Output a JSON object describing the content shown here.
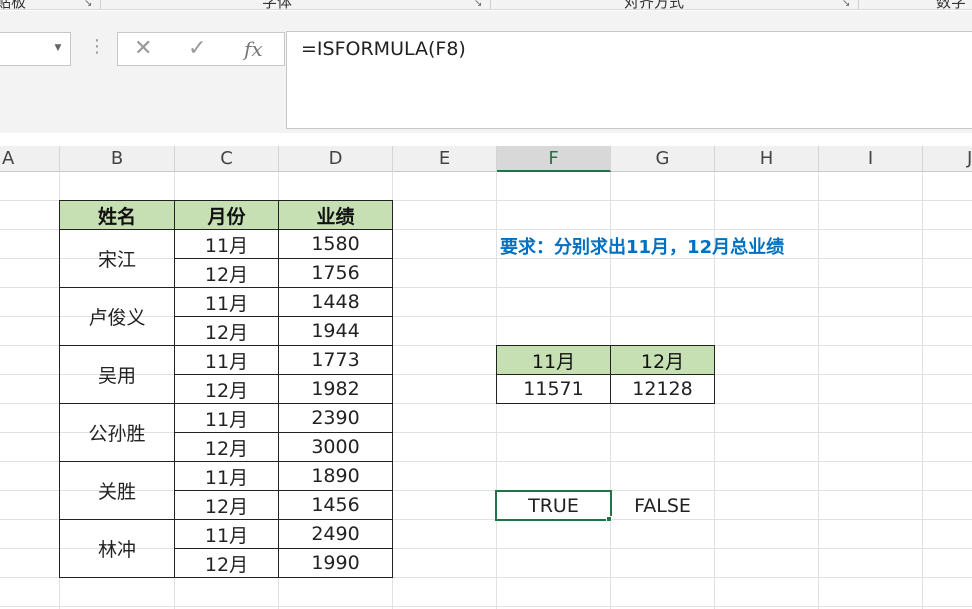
{
  "ribbon": {
    "groups": [
      {
        "label": "贴板"
      },
      {
        "label": "字体"
      },
      {
        "label": "对齐方式"
      },
      {
        "label": "数字"
      }
    ],
    "launcher_icon": "dialog-launcher-icon"
  },
  "formula_bar": {
    "name_box": "",
    "cancel_icon": "✕",
    "enter_icon": "✓",
    "fx_label": "fx",
    "formula": "=ISFORMULA(F8)"
  },
  "columns": [
    {
      "label": "A",
      "selected": false
    },
    {
      "label": "B",
      "selected": false
    },
    {
      "label": "C",
      "selected": false
    },
    {
      "label": "D",
      "selected": false
    },
    {
      "label": "E",
      "selected": false
    },
    {
      "label": "F",
      "selected": true
    },
    {
      "label": "G",
      "selected": false
    },
    {
      "label": "H",
      "selected": false
    },
    {
      "label": "I",
      "selected": false
    },
    {
      "label": "J",
      "selected": false
    }
  ],
  "main_table": {
    "headers": [
      "姓名",
      "月份",
      "业绩"
    ],
    "groups": [
      {
        "name": "宋江",
        "rows": [
          {
            "month": "11月",
            "value": "1580"
          },
          {
            "month": "12月",
            "value": "1756"
          }
        ]
      },
      {
        "name": "卢俊义",
        "rows": [
          {
            "month": "11月",
            "value": "1448"
          },
          {
            "month": "12月",
            "value": "1944"
          }
        ]
      },
      {
        "name": "吴用",
        "rows": [
          {
            "month": "11月",
            "value": "1773"
          },
          {
            "month": "12月",
            "value": "1982"
          }
        ]
      },
      {
        "name": "公孙胜",
        "rows": [
          {
            "month": "11月",
            "value": "2390"
          },
          {
            "month": "12月",
            "value": "3000"
          }
        ]
      },
      {
        "name": "关胜",
        "rows": [
          {
            "month": "11月",
            "value": "1890"
          },
          {
            "month": "12月",
            "value": "1456"
          }
        ]
      },
      {
        "name": "林冲",
        "rows": [
          {
            "month": "11月",
            "value": "2490"
          },
          {
            "month": "12月",
            "value": "1990"
          }
        ]
      }
    ]
  },
  "requirement": "要求：分别求出11月，12月总业绩",
  "summary_table": {
    "headers": [
      "11月",
      "12月"
    ],
    "values": [
      "11571",
      "12128"
    ]
  },
  "results": {
    "f_cell": "TRUE",
    "g_cell": "FALSE"
  },
  "colors": {
    "header_fill": "#c6e0b4",
    "requirement_text": "#0070c0",
    "selection": "#217346"
  }
}
